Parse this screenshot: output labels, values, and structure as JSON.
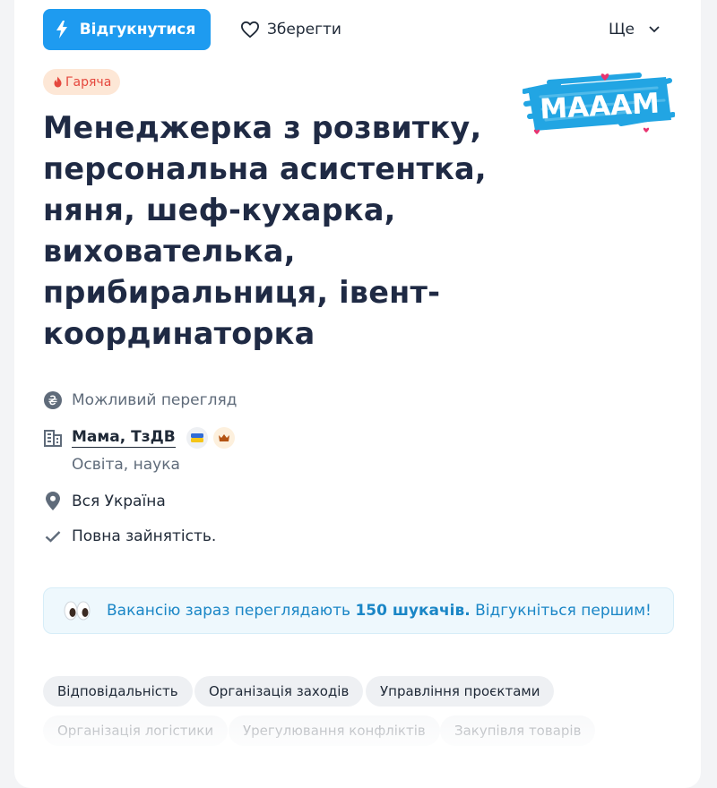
{
  "toolbar": {
    "apply_label": "Відгукнутися",
    "save_label": "Зберегти",
    "more_label": "Ще"
  },
  "badge": {
    "hot_label": "Гаряча",
    "color": "#e5483e"
  },
  "vacancy": {
    "title": "Менеджерка з розвитку, персональна асистентка, няня, шеф-кухарка, вихователька, прибиральниця, івент-координаторка",
    "logo_text": "MAAAM"
  },
  "meta": {
    "salary": "Можливий перегляд",
    "company": "Мама, ТзДВ",
    "industry": "Освіта, наука",
    "location": "Вся Україна",
    "employment": "Повна зайнятість."
  },
  "banner": {
    "text_before": "Вакансію зараз переглядають ",
    "highlight": "150 шукачів.",
    "text_after": " Відгукніться першим!"
  },
  "skills": [
    "Відповідальність",
    "Організація заходів",
    "Управління проєктами",
    "Організація логістики",
    "Урегулювання конфліктів",
    "Закупівля товарів"
  ],
  "colors": {
    "accent": "#1e9bf0",
    "title": "#1f2a44",
    "banner_text": "#1a86c6"
  }
}
